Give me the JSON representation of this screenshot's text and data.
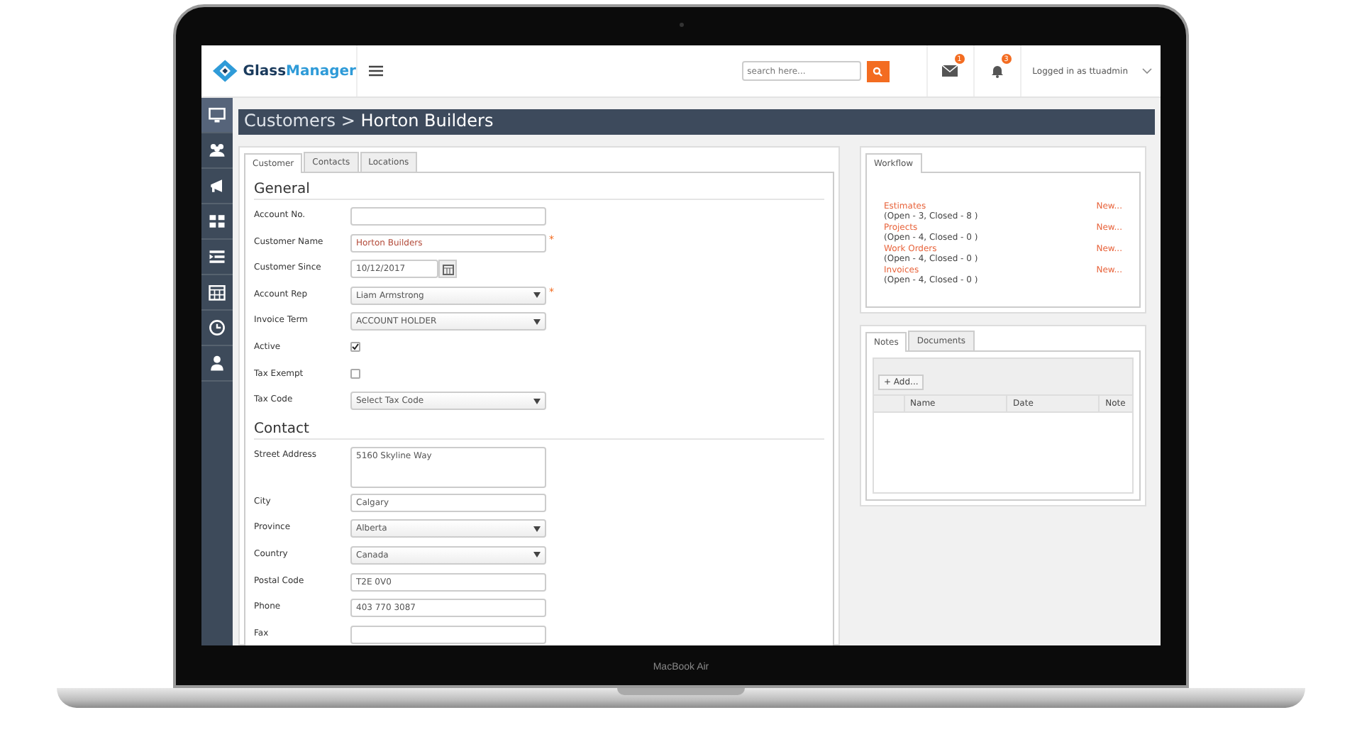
{
  "device": {
    "label": "MacBook Air"
  },
  "header": {
    "logo_text": "Glass",
    "logo_text_bold": "Manager",
    "search": {
      "placeholder": "search here..."
    },
    "mail_badge": "1",
    "bell_badge": "3",
    "user": "Logged in as ttuadmin"
  },
  "sidebar": {
    "items": [
      {
        "selected": true
      },
      {
        "selected": false
      },
      {
        "selected": false
      },
      {
        "selected": false
      },
      {
        "selected": false
      },
      {
        "selected": false
      },
      {
        "selected": false
      },
      {
        "selected": false
      }
    ]
  },
  "page_title": {
    "parent": "Customers",
    "separator": ">",
    "current": "Horton Builders"
  },
  "tabs": [
    {
      "label": "Customer",
      "selected": true
    },
    {
      "label": "Contacts",
      "selected": false
    },
    {
      "label": "Locations",
      "selected": false
    }
  ],
  "sections": [
    {
      "title": "General",
      "fields": [
        {
          "label": "Account No.",
          "kind": "text"
        },
        {
          "label": "Customer Name",
          "kind": "text",
          "value": "Horton Builders",
          "required_mark": "*"
        },
        {
          "label": "Customer Since",
          "kind": "date",
          "value": "10/12/2017"
        },
        {
          "label": "Account Rep",
          "kind": "select",
          "value": "Liam Armstrong",
          "required_mark": "*"
        },
        {
          "label": "Invoice Term",
          "kind": "select",
          "value": "ACCOUNT HOLDER"
        },
        {
          "label": "Active",
          "kind": "checkbox",
          "checked": true
        },
        {
          "label": "Tax Exempt",
          "kind": "checkbox",
          "checked": false
        },
        {
          "label": "Tax Code",
          "kind": "select",
          "value": "Select Tax Code"
        }
      ]
    },
    {
      "title": "Contact",
      "fields": [
        {
          "label": "Street Address",
          "kind": "textarea",
          "value": "5160 Skyline Way"
        },
        {
          "label": "City",
          "kind": "text",
          "value": "Calgary"
        },
        {
          "label": "Province",
          "kind": "select",
          "value": "Alberta"
        },
        {
          "label": "Country",
          "kind": "select",
          "value": "Canada"
        },
        {
          "label": "Postal Code",
          "kind": "text",
          "value": "T2E 0V0"
        },
        {
          "label": "Phone",
          "kind": "text",
          "value": "403 770 3087"
        },
        {
          "label": "Fax",
          "kind": "text"
        }
      ]
    }
  ],
  "workflow": {
    "tab": "Workflow",
    "items": [
      {
        "name": "Estimates",
        "counts": "(Open - 3, Closed - 8 )",
        "action": "New..."
      },
      {
        "name": "Projects",
        "counts": "(Open - 4, Closed - 0 )",
        "action": "New..."
      },
      {
        "name": "Work Orders",
        "counts": "(Open - 4, Closed - 0 )",
        "action": "New..."
      },
      {
        "name": "Invoices",
        "counts": "(Open - 4, Closed - 0 )",
        "action": "New..."
      }
    ]
  },
  "notes": {
    "tabs": [
      {
        "label": "Notes",
        "selected": true
      },
      {
        "label": "Documents",
        "selected": false
      }
    ],
    "add_button": "+ Add...",
    "columns": [
      "Name",
      "Date",
      "Note"
    ]
  }
}
